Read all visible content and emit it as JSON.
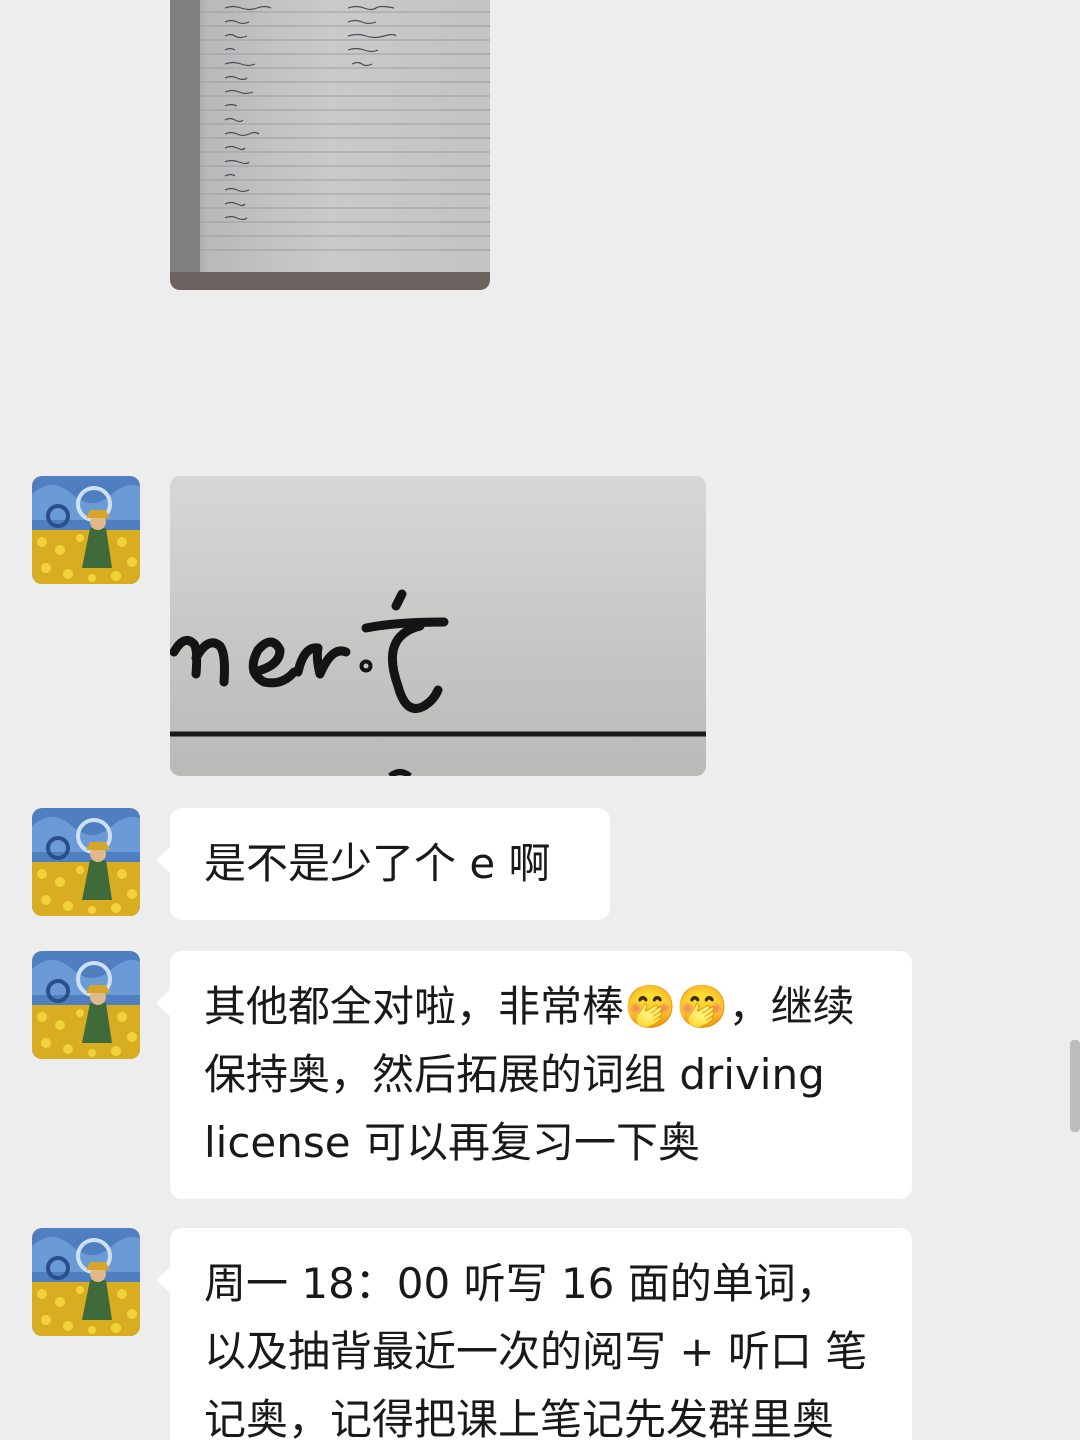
{
  "messages": [
    {
      "type": "image",
      "content": "photo of vocabulary notebook page"
    },
    {
      "type": "image",
      "content": "close-up photo of handwritten word ending \"nent\""
    },
    {
      "type": "text",
      "text": "是不是少了个 e 啊"
    },
    {
      "type": "text",
      "text": "其他都全对啦，非常棒🤭🤭，继续保持奥，然后拓展的词组 driving license 可以再复习一下奥"
    },
    {
      "type": "text",
      "text": "周一 18：00 听写 16 面的单词，以及抽背最近一次的阅写 + 听口 笔记奥，记得把课上笔记先发群里奥"
    }
  ],
  "colors": {
    "background": "#ededed",
    "bubble": "#ffffff",
    "text": "#191919"
  }
}
